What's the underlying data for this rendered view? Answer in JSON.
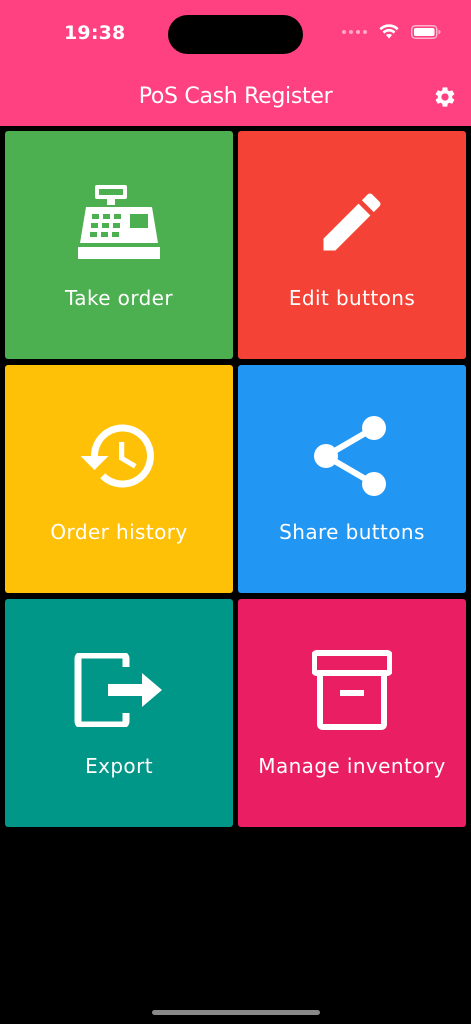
{
  "status_bar": {
    "time": "19:38"
  },
  "app_bar": {
    "title": "PoS Cash Register",
    "settings_icon": "gear-icon"
  },
  "colors": {
    "app_bar": "#FF4081",
    "background": "#000000"
  },
  "tiles": [
    {
      "label": "Take order",
      "icon": "cash-register-icon",
      "color": "#4CAF50"
    },
    {
      "label": "Edit buttons",
      "icon": "pencil-icon",
      "color": "#F44336"
    },
    {
      "label": "Order history",
      "icon": "history-icon",
      "color": "#FFC107"
    },
    {
      "label": "Share buttons",
      "icon": "share-icon",
      "color": "#2196F3"
    },
    {
      "label": "Export",
      "icon": "export-icon",
      "color": "#009688"
    },
    {
      "label": "Manage inventory",
      "icon": "archive-box-icon",
      "color": "#E91E63"
    }
  ]
}
